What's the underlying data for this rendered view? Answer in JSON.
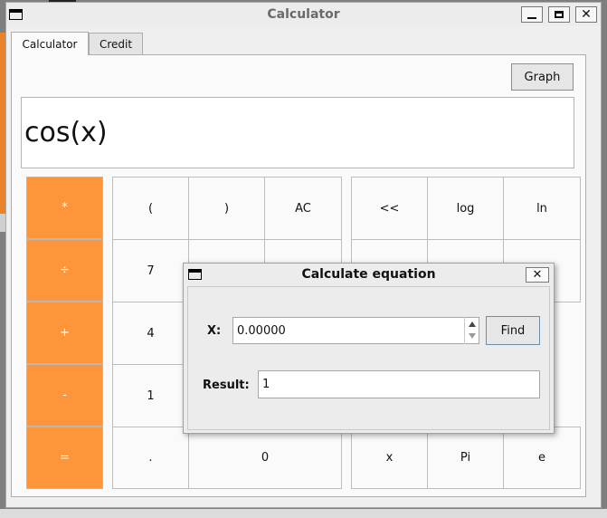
{
  "window": {
    "title": "Calculator"
  },
  "tabs": [
    {
      "label": "Calculator"
    },
    {
      "label": "Credit"
    }
  ],
  "graph_button": "Graph",
  "display": {
    "expression": "cos(x)"
  },
  "keypad": {
    "operators": [
      "*",
      "÷",
      "+",
      "-",
      "="
    ],
    "row1": [
      "(",
      ")",
      "AC",
      "<<",
      "log",
      "ln"
    ],
    "row2": [
      "7"
    ],
    "row3": [
      "4"
    ],
    "row4": [
      "1"
    ],
    "row5": [
      ".",
      "0",
      "x",
      "Pi",
      "e"
    ]
  },
  "dialog": {
    "title": "Calculate equation",
    "x_label": "X:",
    "x_value": "0.00000",
    "find_button": "Find",
    "result_label": "Result:",
    "result_value": "1"
  },
  "colors": {
    "operator_orange": "#fd953b"
  },
  "icons": [
    "window-menu-icon",
    "minimize-icon",
    "maximize-icon",
    "close-icon",
    "spin-up-icon",
    "spin-down-icon"
  ]
}
